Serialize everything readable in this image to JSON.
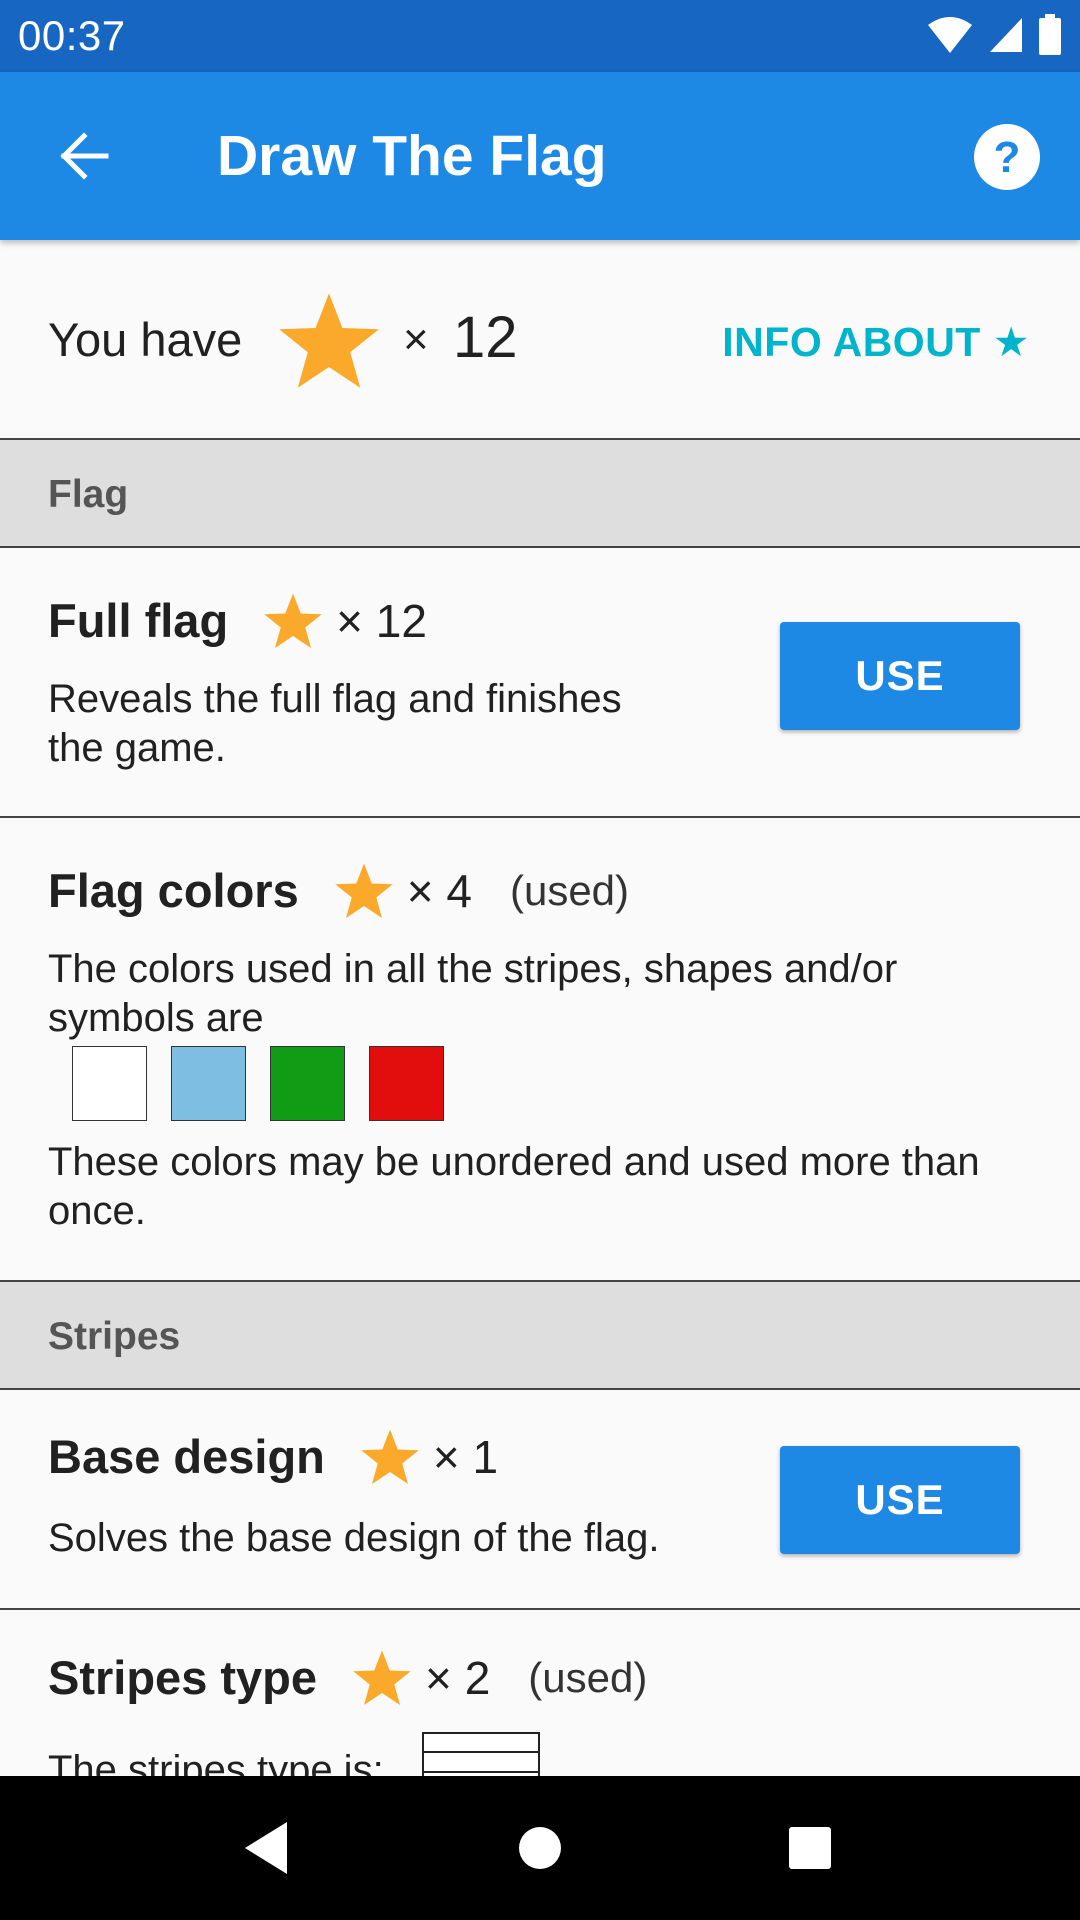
{
  "status_bar": {
    "time": "00:37"
  },
  "app_bar": {
    "title": "Draw The Flag"
  },
  "stars": {
    "label": "You have",
    "times": "×",
    "count": "12",
    "info_link": "INFO ABOUT ★",
    "star_color": "#FBA92B"
  },
  "sections": {
    "flag": {
      "header": "Flag"
    },
    "stripes": {
      "header": "Stripes"
    }
  },
  "items": {
    "full_flag": {
      "title": "Full flag",
      "cost": "× 12",
      "description": "Reveals the full flag and finishes the game.",
      "button": "USE"
    },
    "flag_colors": {
      "title": "Flag colors",
      "cost": "× 4",
      "status": "(used)",
      "description": "The colors used in all the stripes, shapes and/or symbols are",
      "colors": [
        "#FFFFFF",
        "#7FBEE3",
        "#109C14",
        "#E20E0E"
      ],
      "note": "These colors may be unordered and used more than once."
    },
    "base_design": {
      "title": "Base design",
      "cost": "× 1",
      "description": "Solves the base design of the flag.",
      "button": "USE"
    },
    "stripes_type": {
      "title": "Stripes type",
      "cost": "× 2",
      "status": "(used)",
      "description": "The stripes type is:"
    }
  },
  "colors": {
    "primary": "#1E88E5",
    "status_bar": "#1766C1",
    "accent": "#00B4CC"
  }
}
